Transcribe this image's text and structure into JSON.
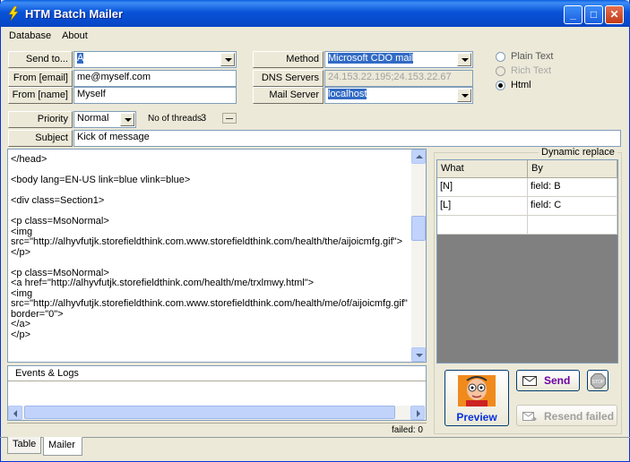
{
  "window": {
    "title": "HTM Batch Mailer"
  },
  "menu": {
    "items": [
      "Database",
      "About"
    ]
  },
  "form": {
    "send_to": {
      "label": "Send to...",
      "value": "A"
    },
    "from_email": {
      "label": "From [email]",
      "value": "me@myself.com"
    },
    "from_name": {
      "label": "From [name]",
      "value": "Myself"
    },
    "method": {
      "label": "Method",
      "value": "Microsoft CDO mail"
    },
    "dns_servers": {
      "label": "DNS Servers",
      "value": "24.153.22.195;24.153.22.67"
    },
    "mail_server": {
      "label": "Mail Server",
      "value": "localhost"
    },
    "priority": {
      "label": "Priority",
      "value": "Normal"
    },
    "threads": {
      "label": "No of threads",
      "value": "3"
    },
    "subject": {
      "label": "Subject",
      "value": "Kick of message"
    }
  },
  "format_options": {
    "plain_text": {
      "label": "Plain Text",
      "selected": false,
      "enabled": true
    },
    "rich_text": {
      "label": "Rich Text",
      "selected": false,
      "enabled": false
    },
    "html": {
      "label": "Html",
      "selected": true,
      "enabled": true
    }
  },
  "editor": {
    "content": "</head>\n\n<body lang=EN-US link=blue vlink=blue>\n\n<div class=Section1>\n\n<p class=MsoNormal>\n<img\nsrc=\"http://alhyvfutjk.storefieldthink.com.www.storefieldthink.com/health/the/aijoicmfg.gif\">\n</p>\n\n<p class=MsoNormal>\n<a href=\"http://alhyvfutjk.storefieldthink.com/health/me/trxlmwy.html\">\n<img\nsrc=\"http://alhyvfutjk.storefieldthink.com.www.storefieldthink.com/health/me/of/aijoicmfg.gif\"\nborder=\"0\">\n</a>\n</p>"
  },
  "events": {
    "title": "Events & Logs",
    "failed": "failed: 0"
  },
  "dynamic_replace": {
    "title": "Dynamic replace",
    "columns": [
      "What",
      "By"
    ],
    "rows": [
      {
        "what": "[N]",
        "by": "field: B"
      },
      {
        "what": "[L]",
        "by": "field: C"
      }
    ]
  },
  "buttons": {
    "preview": "Preview",
    "send": "Send",
    "resend_failed": "Resend failed"
  },
  "tabs": [
    "Table",
    "Mailer"
  ],
  "active_tab": "Mailer",
  "colors": {
    "title_bar": "#0a5fe0",
    "selection": "#316ac5",
    "send_label": "#6b00a0",
    "preview_label": "#0831d9"
  }
}
